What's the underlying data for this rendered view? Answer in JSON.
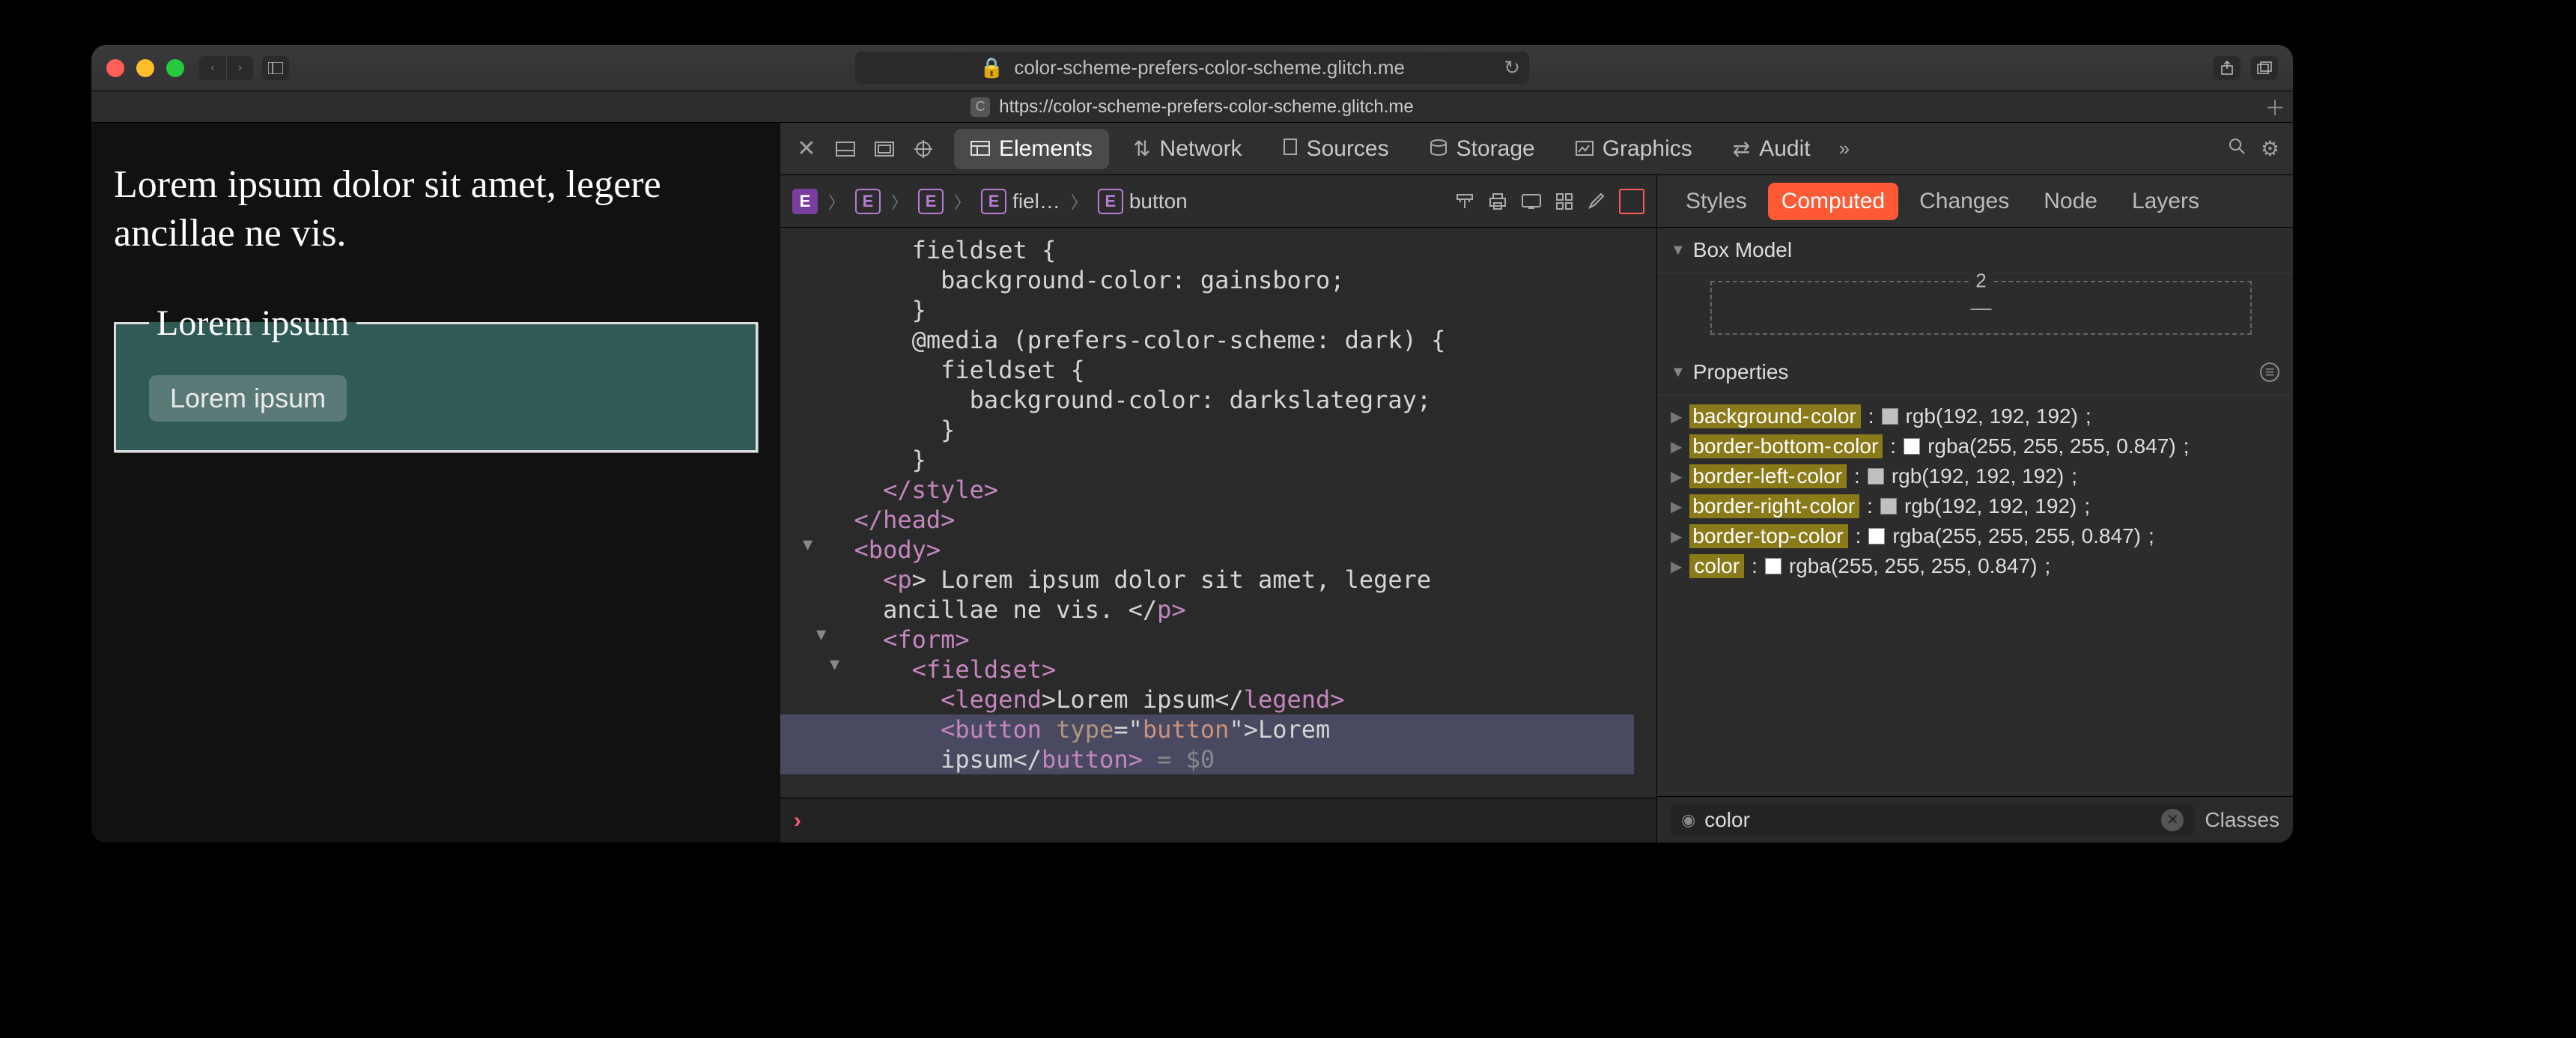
{
  "browser": {
    "url_display": "color-scheme-prefers-color-scheme.glitch.me",
    "tab_url": "https://color-scheme-prefers-color-scheme.glitch.me",
    "tab_favicon": "C"
  },
  "page": {
    "paragraph": "Lorem ipsum dolor sit amet, legere ancillae ne vis.",
    "legend": "Lorem ipsum",
    "button": "Lorem ipsum"
  },
  "devtools": {
    "tabs": {
      "elements": "Elements",
      "network": "Network",
      "sources": "Sources",
      "storage": "Storage",
      "graphics": "Graphics",
      "audit": "Audit"
    },
    "breadcrumbs": {
      "fiel": "fiel…",
      "button": "button"
    },
    "source_lines": {
      "l1": "      fieldset {",
      "l2": "        background-color: gainsboro;",
      "l3": "      }",
      "l4": "      @media (prefers-color-scheme: dark) {",
      "l5": "        fieldset {",
      "l6": "          background-color: darkslategray;",
      "l7": "        }",
      "l8": "      }",
      "l9_a": "    </",
      "l9_b": "style",
      "l9_c": ">",
      "l10_a": "  </",
      "l10_b": "head",
      "l10_c": ">",
      "l11_a": "  <",
      "l11_b": "body",
      "l11_c": ">",
      "l12_a": "    <",
      "l12_b": "p",
      "l12_c": "> Lorem ipsum dolor sit amet, legere",
      "l12d": "    ancillae ne vis. </",
      "l12e": "p",
      "l12f": ">",
      "l13_a": "    <",
      "l13_b": "form",
      "l13_c": ">",
      "l14_a": "      <",
      "l14_b": "fieldset",
      "l14_c": ">",
      "l15_a": "        <",
      "l15_b": "legend",
      "l15_c": ">Lorem ipsum</",
      "l15_d": "legend",
      "l15_e": ">",
      "l16_a": "        <",
      "l16_b": "button",
      "l16_c": " type",
      "l16_d": "=\"",
      "l16_e": "button",
      "l16_f": "\">Lorem",
      "l17_a": "        ipsum</",
      "l17_b": "button",
      "l17_c": "> ",
      "l17_d": "= $0"
    },
    "right": {
      "tabs": {
        "styles": "Styles",
        "computed": "Computed",
        "changes": "Changes",
        "node": "Node",
        "layers": "Layers"
      },
      "box_model_title": "Box Model",
      "bm_top": "2",
      "bm_dash": "—",
      "properties_title": "Properties",
      "props": [
        {
          "name": "background-color",
          "swatch": "#c0c0c0",
          "value": "rgb(192, 192, 192)"
        },
        {
          "name": "border-bottom-color",
          "swatch": "#ffffff",
          "value": "rgba(255, 255, 255, 0.847)"
        },
        {
          "name": "border-left-color",
          "swatch": "#c0c0c0",
          "value": "rgb(192, 192, 192)"
        },
        {
          "name": "border-right-color",
          "swatch": "#c0c0c0",
          "value": "rgb(192, 192, 192)"
        },
        {
          "name": "border-top-color",
          "swatch": "#ffffff",
          "value": "rgba(255, 255, 255, 0.847)"
        },
        {
          "name": "color",
          "swatch": "#ffffff",
          "value": "rgba(255, 255, 255, 0.847)"
        }
      ],
      "filter_value": "color",
      "classes_label": "Classes"
    }
  }
}
